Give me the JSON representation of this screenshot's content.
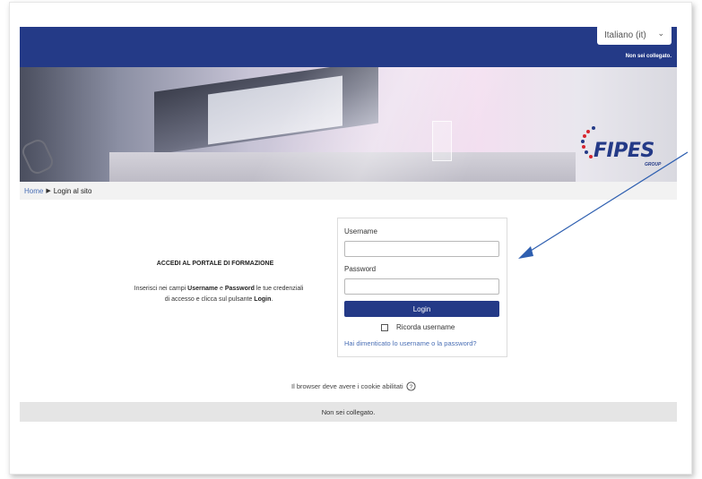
{
  "header": {
    "language_select": "Italiano (it)",
    "login_status": "Non sei collegato."
  },
  "brand": {
    "logo_text": "FIPES",
    "logo_subtext": "GROUP",
    "color_primary": "#243a87"
  },
  "breadcrumb": {
    "home": "Home",
    "separator": "▶",
    "current": "Login al sito"
  },
  "info": {
    "title": "ACCEDI AL PORTALE DI FORMAZIONE",
    "body_1": "Inserisci nei campi ",
    "body_username": "Username",
    "body_2": " e ",
    "body_password": "Password",
    "body_3": " le tue credenziali di accesso e clicca sul pulsante ",
    "body_login": "Login",
    "body_4": "."
  },
  "login_form": {
    "username_label": "Username",
    "username_value": "",
    "password_label": "Password",
    "password_value": "",
    "login_button": "Login",
    "remember_label": "Ricorda username",
    "remember_checked": false,
    "forgot_link": "Hai dimenticato lo username o la password?"
  },
  "cookies_notice": "Il browser deve avere i cookie abilitati",
  "footer": {
    "login_status": "Non sei collegato."
  }
}
